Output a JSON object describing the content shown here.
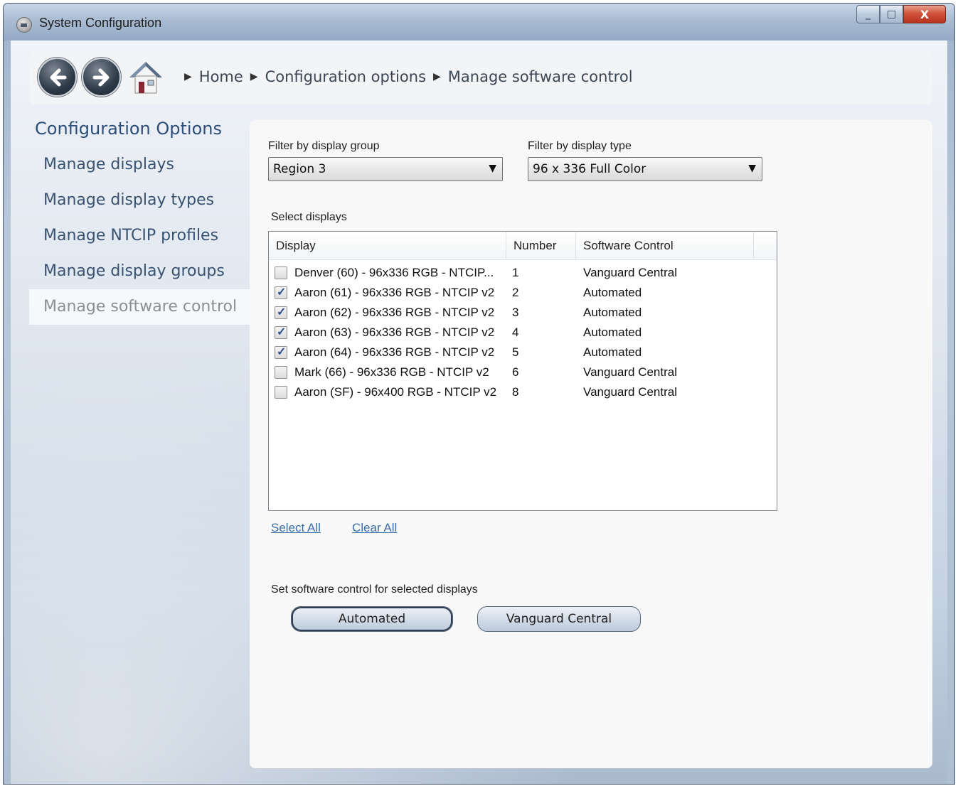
{
  "window": {
    "title": "System Configuration",
    "close_glyph": "X",
    "min_glyph": "_",
    "max_glyph": "□"
  },
  "nav": {
    "back_icon": "back-arrow-icon",
    "forward_icon": "forward-arrow-icon",
    "home_icon": "home-icon",
    "breadcrumb": [
      "Home",
      "Configuration options",
      "Manage software control"
    ]
  },
  "sidebar": {
    "title": "Configuration Options",
    "items": [
      {
        "label": "Manage displays"
      },
      {
        "label": "Manage display types"
      },
      {
        "label": "Manage NTCIP profiles"
      },
      {
        "label": "Manage display groups"
      },
      {
        "label": "Manage software control"
      }
    ]
  },
  "filters": {
    "group_label": "Filter by display group",
    "group_value": "Region 3",
    "type_label": "Filter by display type",
    "type_value": "96 x 336 Full Color"
  },
  "list": {
    "label": "Select displays",
    "columns": [
      "Display",
      "Number",
      "Software Control"
    ],
    "rows": [
      {
        "display": "Denver (60) - 96x336 RGB - NTCIP...",
        "number": "1",
        "control": "Vanguard Central",
        "checked": false
      },
      {
        "display": "Aaron (61) - 96x336 RGB - NTCIP v2",
        "number": "2",
        "control": "Automated",
        "checked": true
      },
      {
        "display": "Aaron (62) - 96x336 RGB - NTCIP v2",
        "number": "3",
        "control": "Automated",
        "checked": true
      },
      {
        "display": "Aaron (63) - 96x336 RGB - NTCIP v2",
        "number": "4",
        "control": "Automated",
        "checked": true
      },
      {
        "display": "Aaron (64) - 96x336 RGB - NTCIP v2",
        "number": "5",
        "control": "Automated",
        "checked": true
      },
      {
        "display": "Mark (66) - 96x336 RGB - NTCIP v2",
        "number": "6",
        "control": "Vanguard Central",
        "checked": false
      },
      {
        "display": "Aaron (SF) - 96x400 RGB - NTCIP v2",
        "number": "8",
        "control": "Vanguard Central",
        "checked": false
      }
    ]
  },
  "actions": {
    "select_all": "Select All",
    "clear_all": "Clear All",
    "set_label": "Set software control for selected displays",
    "automated": "Automated",
    "vanguard": "Vanguard Central"
  }
}
